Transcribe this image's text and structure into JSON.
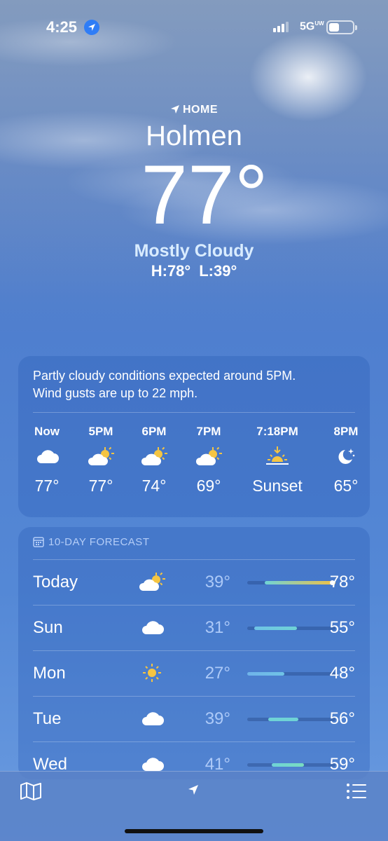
{
  "status_bar": {
    "time": "4:25",
    "network": "5G",
    "network_superscript": "UW"
  },
  "location": {
    "home_label": "HOME",
    "city": "Holmen",
    "temperature": "77°",
    "condition": "Mostly Cloudy",
    "high": "H:78°",
    "low": "L:39°"
  },
  "hourly": {
    "summary_line1": "Partly cloudy conditions expected around 5PM.",
    "summary_line2": "Wind gusts are up to 22 mph.",
    "items": [
      {
        "time": "Now",
        "icon": "cloud-icon",
        "temp": "77°"
      },
      {
        "time": "5PM",
        "icon": "partly-sunny-icon",
        "temp": "77°"
      },
      {
        "time": "6PM",
        "icon": "partly-sunny-icon",
        "temp": "74°"
      },
      {
        "time": "7PM",
        "icon": "partly-sunny-icon",
        "temp": "69°"
      },
      {
        "time": "7:18PM",
        "icon": "sunset-icon",
        "temp": "Sunset"
      },
      {
        "time": "8PM",
        "icon": "moon-stars-icon",
        "temp": "65°"
      }
    ]
  },
  "forecast": {
    "header": "10-DAY FORECAST",
    "days": [
      {
        "name": "Today",
        "icon": "partly-sunny-icon",
        "low": "39°",
        "high": "78°",
        "range_start": 0.2,
        "range_end": 1.0,
        "colors": [
          "#6fd3d6",
          "#f2c043"
        ]
      },
      {
        "name": "Sun",
        "icon": "cloud-icon",
        "low": "31°",
        "high": "55°",
        "range_start": 0.08,
        "range_end": 0.56,
        "colors": [
          "#6fc3e6",
          "#6fd3d6"
        ]
      },
      {
        "name": "Mon",
        "icon": "sun-icon",
        "low": "27°",
        "high": "48°",
        "range_start": 0.0,
        "range_end": 0.42,
        "colors": [
          "#6fb3ea",
          "#6fc3e6"
        ]
      },
      {
        "name": "Tue",
        "icon": "cloud-icon",
        "low": "39°",
        "high": "56°",
        "range_start": 0.24,
        "range_end": 0.58,
        "colors": [
          "#6fd3d6",
          "#6fd3d6"
        ]
      },
      {
        "name": "Wed",
        "icon": "cloud-icon",
        "low": "41°",
        "high": "59°",
        "range_start": 0.28,
        "range_end": 0.64,
        "colors": [
          "#6fd3d6",
          "#79dcc0"
        ]
      }
    ]
  },
  "colors": {
    "accent": "#2f7df6",
    "condition_text": "#d9ecff"
  }
}
